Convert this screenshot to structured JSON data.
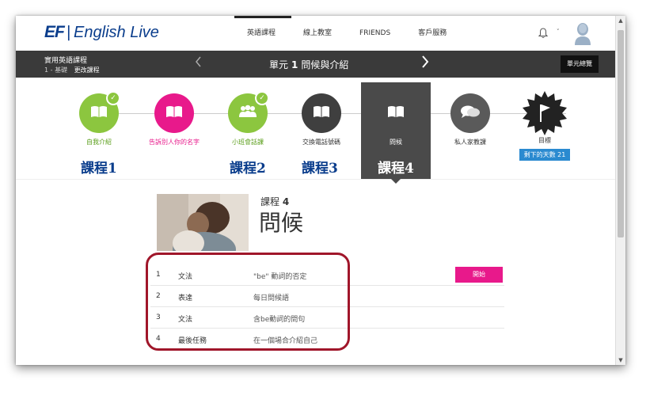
{
  "nav": {
    "logo_ef": "EF",
    "logo_sep": "|",
    "logo_name": "English Live",
    "links": [
      "英語課程",
      "線上教室",
      "FRIENDS",
      "客戶服務"
    ],
    "notification_caret": "˅"
  },
  "unit_bar": {
    "course_title": "實用英語課程",
    "course_level": "1 - 基礎",
    "change_course": "更改課程",
    "unit_prefix": "單元",
    "unit_number": "1",
    "unit_name": "問候與介紹",
    "overview_button": "單元總覽"
  },
  "steps": [
    {
      "label": "自我介紹",
      "color": "#8cc63f",
      "icon": "book-icon",
      "completed": true
    },
    {
      "label": "告訴別人你的名字",
      "color": "#e8198b",
      "icon": "book-icon",
      "completed": false
    },
    {
      "label": "小班會話課",
      "color": "#8cc63f",
      "icon": "group-icon",
      "completed": true
    },
    {
      "label": "交換電話號碼",
      "color": "#3f3f3f",
      "icon": "book-icon",
      "completed": false
    },
    {
      "label": "問候",
      "color": "#4a4a4a",
      "icon": "book-icon",
      "completed": false,
      "active": true
    },
    {
      "label": "私人家教課",
      "color": "#5a5a5a",
      "icon": "chat-icon",
      "completed": false
    },
    {
      "label": "目標",
      "color": "#222222",
      "icon": "flag-icon",
      "completed": false
    }
  ],
  "goal_badge": "剩下的天數 21",
  "lesson_annotations": [
    "課程1",
    "課程2",
    "課程3",
    "課程4"
  ],
  "lesson": {
    "prefix": "課程",
    "number": "4",
    "title": "問候"
  },
  "activities": [
    {
      "num": "1",
      "type": "文法",
      "desc": "\"be\" 動詞的否定"
    },
    {
      "num": "2",
      "type": "表達",
      "desc": "每日問候語"
    },
    {
      "num": "3",
      "type": "文法",
      "desc": "含be動詞的問句"
    },
    {
      "num": "4",
      "type": "最後任務",
      "desc": "在一個場合介紹自己"
    }
  ],
  "start_button": "開始",
  "colors": {
    "accent_pink": "#e8198b",
    "green": "#8cc63f",
    "brand_blue": "#0a3d8c",
    "highlight_red": "#a0162a"
  }
}
